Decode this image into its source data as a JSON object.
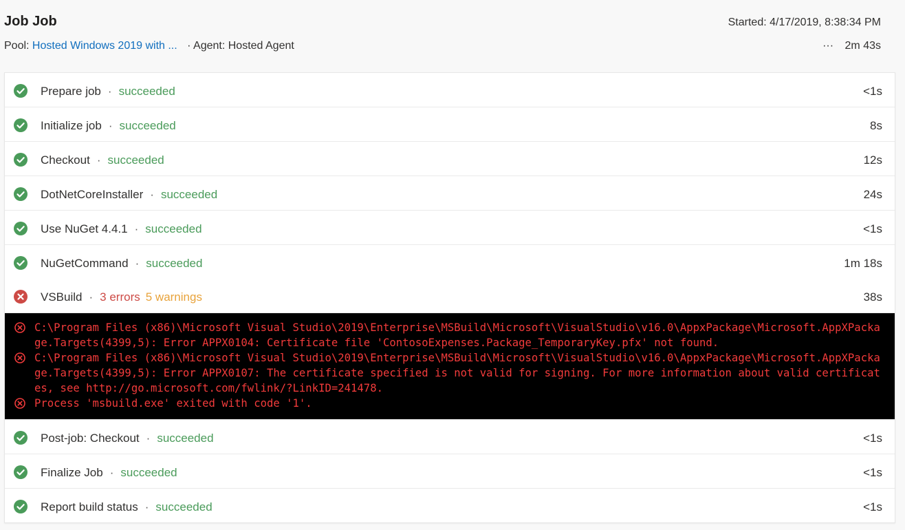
{
  "header": {
    "title": "Job Job",
    "pool_label": "Pool:",
    "pool_value": "Hosted Windows 2019 with ...",
    "agent": "· Agent: Hosted Agent",
    "started": "Started: 4/17/2019, 8:38:34 PM",
    "more": "···",
    "total_duration": "2m 43s"
  },
  "colors": {
    "success": "#4a9b5a",
    "error": "#cd4a45",
    "warning": "#e8a33b",
    "link": "#106ebe",
    "log_text": "#f23b3b"
  },
  "steps_before": [
    {
      "name": "Prepare job",
      "status": "succeeded",
      "duration": "<1s"
    },
    {
      "name": "Initialize job",
      "status": "succeeded",
      "duration": "8s"
    },
    {
      "name": "Checkout",
      "status": "succeeded",
      "duration": "12s"
    },
    {
      "name": "DotNetCoreInstaller",
      "status": "succeeded",
      "duration": "24s"
    },
    {
      "name": "Use NuGet 4.4.1",
      "status": "succeeded",
      "duration": "<1s"
    },
    {
      "name": "NuGetCommand",
      "status": "succeeded",
      "duration": "1m 18s"
    }
  ],
  "failed_step": {
    "name": "VSBuild",
    "errors": "3 errors",
    "warnings": "5 warnings",
    "duration": "38s",
    "log": [
      "C:\\Program Files (x86)\\Microsoft Visual Studio\\2019\\Enterprise\\MSBuild\\Microsoft\\VisualStudio\\v16.0\\AppxPackage\\Microsoft.AppXPackage.Targets(4399,5): Error APPX0104: Certificate file 'ContosoExpenses.Package_TemporaryKey.pfx' not found.",
      "C:\\Program Files (x86)\\Microsoft Visual Studio\\2019\\Enterprise\\MSBuild\\Microsoft\\VisualStudio\\v16.0\\AppxPackage\\Microsoft.AppXPackage.Targets(4399,5): Error APPX0107: The certificate specified is not valid for signing. For more information about valid certificates, see http://go.microsoft.com/fwlink/?LinkID=241478.",
      "Process 'msbuild.exe' exited with code '1'."
    ]
  },
  "steps_after": [
    {
      "name": "Post-job: Checkout",
      "status": "succeeded",
      "duration": "<1s"
    },
    {
      "name": "Finalize Job",
      "status": "succeeded",
      "duration": "<1s"
    },
    {
      "name": "Report build status",
      "status": "succeeded",
      "duration": "<1s"
    }
  ]
}
